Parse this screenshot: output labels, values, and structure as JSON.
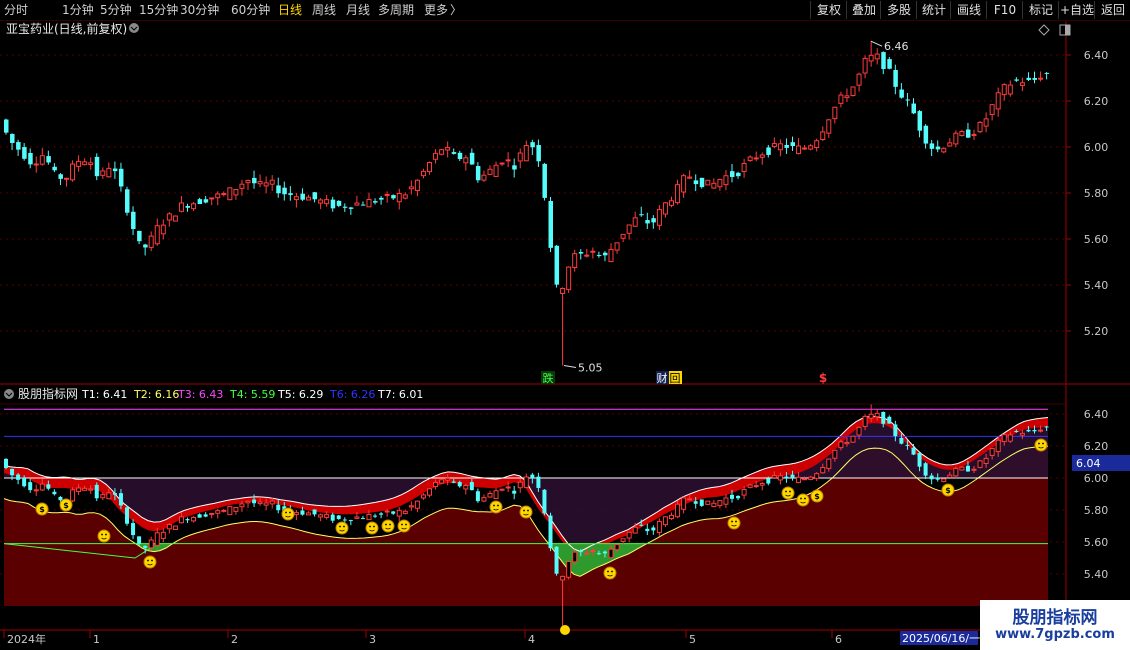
{
  "toolbar": {
    "periods": [
      {
        "label": "分时",
        "active": false
      },
      {
        "label": "1分钟",
        "active": false
      },
      {
        "label": "5分钟",
        "active": false
      },
      {
        "label": "15分钟",
        "active": false
      },
      {
        "label": "30分钟",
        "active": false
      },
      {
        "label": "60分钟",
        "active": false
      },
      {
        "label": "日线",
        "active": true
      },
      {
        "label": "周线",
        "active": false
      },
      {
        "label": "月线",
        "active": false
      },
      {
        "label": "多周期",
        "active": false
      },
      {
        "label": "更多",
        "active": false
      }
    ],
    "more_arrow": "〉",
    "right_buttons": [
      "复权",
      "叠加",
      "多股",
      "统计",
      "画线",
      "F10",
      "标记",
      "+自选",
      "返回"
    ]
  },
  "stock": {
    "title": "亚宝药业(日线,前复权)"
  },
  "main_axis": {
    "ticks": [
      "6.40",
      "6.20",
      "6.00",
      "5.80",
      "5.60",
      "5.40",
      "5.20"
    ]
  },
  "price_annotations": {
    "high": "6.46",
    "low": "5.05"
  },
  "event_markers": [
    "跌",
    "财",
    "回",
    "$"
  ],
  "indicator": {
    "name": "股朋指标网",
    "values": [
      {
        "label": "T1: 6.41",
        "color": "#ffffff"
      },
      {
        "label": "T2: 6.16",
        "color": "#ffff66"
      },
      {
        "label": "T3: 6.43",
        "color": "#ff44ff"
      },
      {
        "label": "T4: 5.59",
        "color": "#44ff44"
      },
      {
        "label": "T5: 6.29",
        "color": "#ffffff"
      },
      {
        "label": "T6: 6.26",
        "color": "#3333ff"
      },
      {
        "label": "T7: 6.01",
        "color": "#ffffff"
      }
    ],
    "current_value": "6.04"
  },
  "ind_axis": {
    "ticks": [
      "6.40",
      "6.20",
      "6.00",
      "5.80",
      "5.60",
      "5.40"
    ]
  },
  "date_axis": {
    "labels": [
      "2024年",
      "1",
      "2",
      "3",
      "4",
      "5",
      "6"
    ],
    "cursor_label": "2025/06/16/一"
  },
  "watermark": {
    "line1": "股朋指标网",
    "line2": "www.7gpzb.com"
  },
  "colors": {
    "up": "#ff3c3c",
    "down": "#54fcfc",
    "axis": "#a00000",
    "band_red": "#cc0000",
    "band_dark": "#5a0000",
    "band_green": "#2e9a2e",
    "purple": "#2a1030"
  }
}
